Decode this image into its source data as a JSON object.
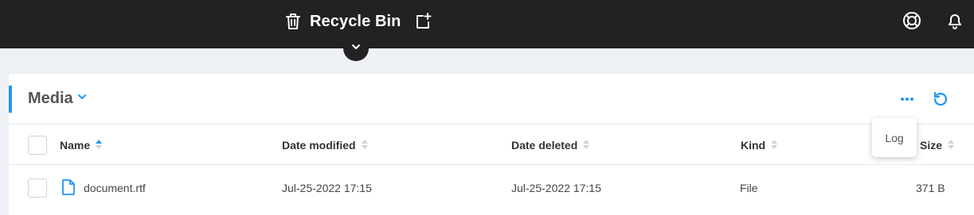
{
  "header": {
    "title": "Recycle Bin",
    "icons": {
      "trash": "trash-icon",
      "add": "add-window-icon",
      "help": "help-lifebuoy-icon",
      "notifications": "bell-icon",
      "toggle": "chevron-down-icon"
    },
    "background": "#222222"
  },
  "card": {
    "title": "Media",
    "accent_color": "#2196f3",
    "actions": [
      "more-horizontal-icon",
      "refresh-icon"
    ]
  },
  "table": {
    "columns": [
      {
        "label": "Name",
        "sort": "ascending"
      },
      {
        "label": "Date modified",
        "sort": "none"
      },
      {
        "label": "Date deleted",
        "sort": "none"
      },
      {
        "label": "Kind",
        "sort": "none"
      },
      {
        "label": "Size",
        "sort": "none"
      }
    ],
    "rows": [
      {
        "name": "document.rtf",
        "date_modified": "Jul-25-2022 17:15",
        "date_deleted": "Jul-25-2022 17:15",
        "kind": "File",
        "size": "371 B",
        "icon": "file-icon"
      }
    ]
  },
  "popup": {
    "item": "Log"
  }
}
